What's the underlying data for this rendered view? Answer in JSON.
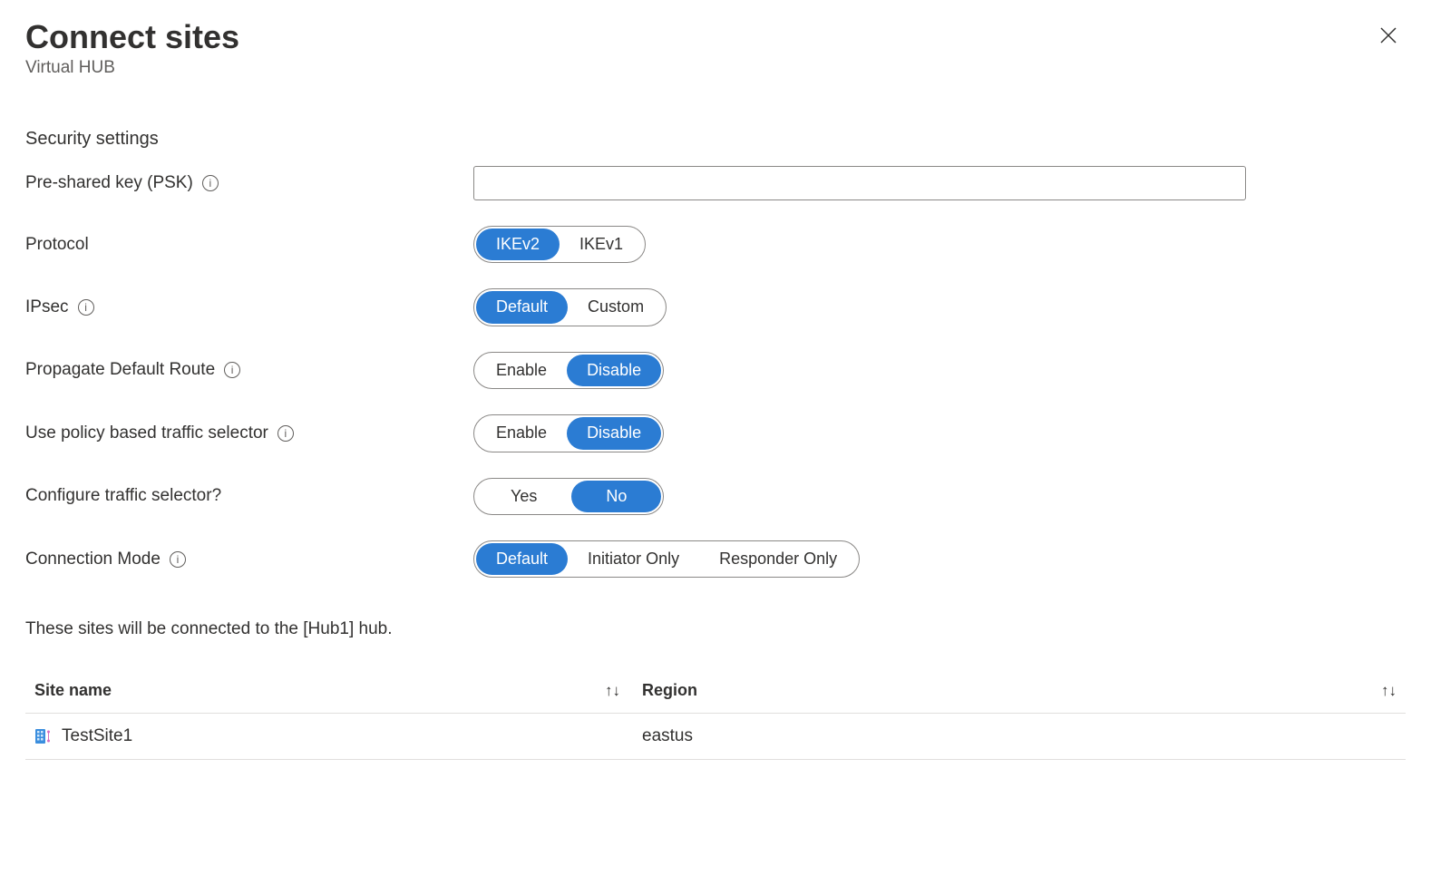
{
  "header": {
    "title": "Connect sites",
    "subtitle": "Virtual HUB"
  },
  "section_title": "Security settings",
  "fields": {
    "psk": {
      "label": "Pre-shared key (PSK)",
      "value": "",
      "info": true
    },
    "protocol": {
      "label": "Protocol",
      "options": [
        "IKEv2",
        "IKEv1"
      ],
      "selected": "IKEv2",
      "info": false
    },
    "ipsec": {
      "label": "IPsec",
      "options": [
        "Default",
        "Custom"
      ],
      "selected": "Default",
      "info": true
    },
    "propagate": {
      "label": "Propagate Default Route",
      "options": [
        "Enable",
        "Disable"
      ],
      "selected": "Disable",
      "info": true
    },
    "policy_selector": {
      "label": "Use policy based traffic selector",
      "options": [
        "Enable",
        "Disable"
      ],
      "selected": "Disable",
      "info": true
    },
    "configure_selector": {
      "label": "Configure traffic selector?",
      "options": [
        "Yes",
        "No"
      ],
      "selected": "No",
      "info": false
    },
    "connection_mode": {
      "label": "Connection Mode",
      "options": [
        "Default",
        "Initiator Only",
        "Responder Only"
      ],
      "selected": "Default",
      "info": true
    }
  },
  "note": "These sites will be connected to the [Hub1] hub.",
  "table": {
    "columns": [
      "Site name",
      "Region"
    ],
    "rows": [
      {
        "name": "TestSite1",
        "region": "eastus"
      }
    ]
  }
}
